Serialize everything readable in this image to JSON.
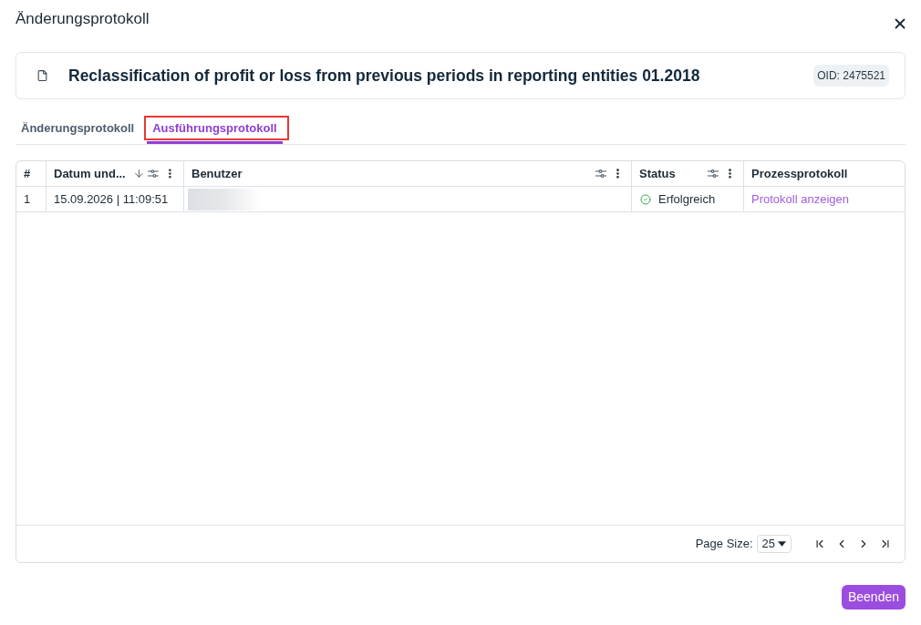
{
  "dialog": {
    "title": "Änderungsprotokoll"
  },
  "record": {
    "title": "Reclassification of profit or loss from previous periods in reporting entities 01.2018",
    "oid": "OID: 2475521"
  },
  "tabs": [
    {
      "label": "Änderungsprotokoll",
      "selected": false,
      "highlighted": false
    },
    {
      "label": "Ausführungsprotokoll",
      "selected": true,
      "highlighted": true
    }
  ],
  "table": {
    "columns": [
      {
        "label": "#",
        "sorted": false,
        "filter": false,
        "menu": false
      },
      {
        "label": "Datum und...",
        "sorted": true,
        "filter": true,
        "menu": true
      },
      {
        "label": "Benutzer",
        "sorted": false,
        "filter": true,
        "menu": true
      },
      {
        "label": "Status",
        "sorted": false,
        "filter": true,
        "menu": true
      },
      {
        "label": "Prozessprotokoll",
        "sorted": false,
        "filter": false,
        "menu": false
      }
    ],
    "rows": [
      {
        "number": "1",
        "date": "15.09.2026 | 11:09:51",
        "user_hidden": true,
        "status": {
          "label": "Erfolgreich",
          "kind": "success"
        },
        "log_link": "Protokoll anzeigen"
      }
    ]
  },
  "pagination": {
    "page_size_label": "Page Size:",
    "page_size": "25"
  },
  "buttons": [
    "Beenden"
  ]
}
